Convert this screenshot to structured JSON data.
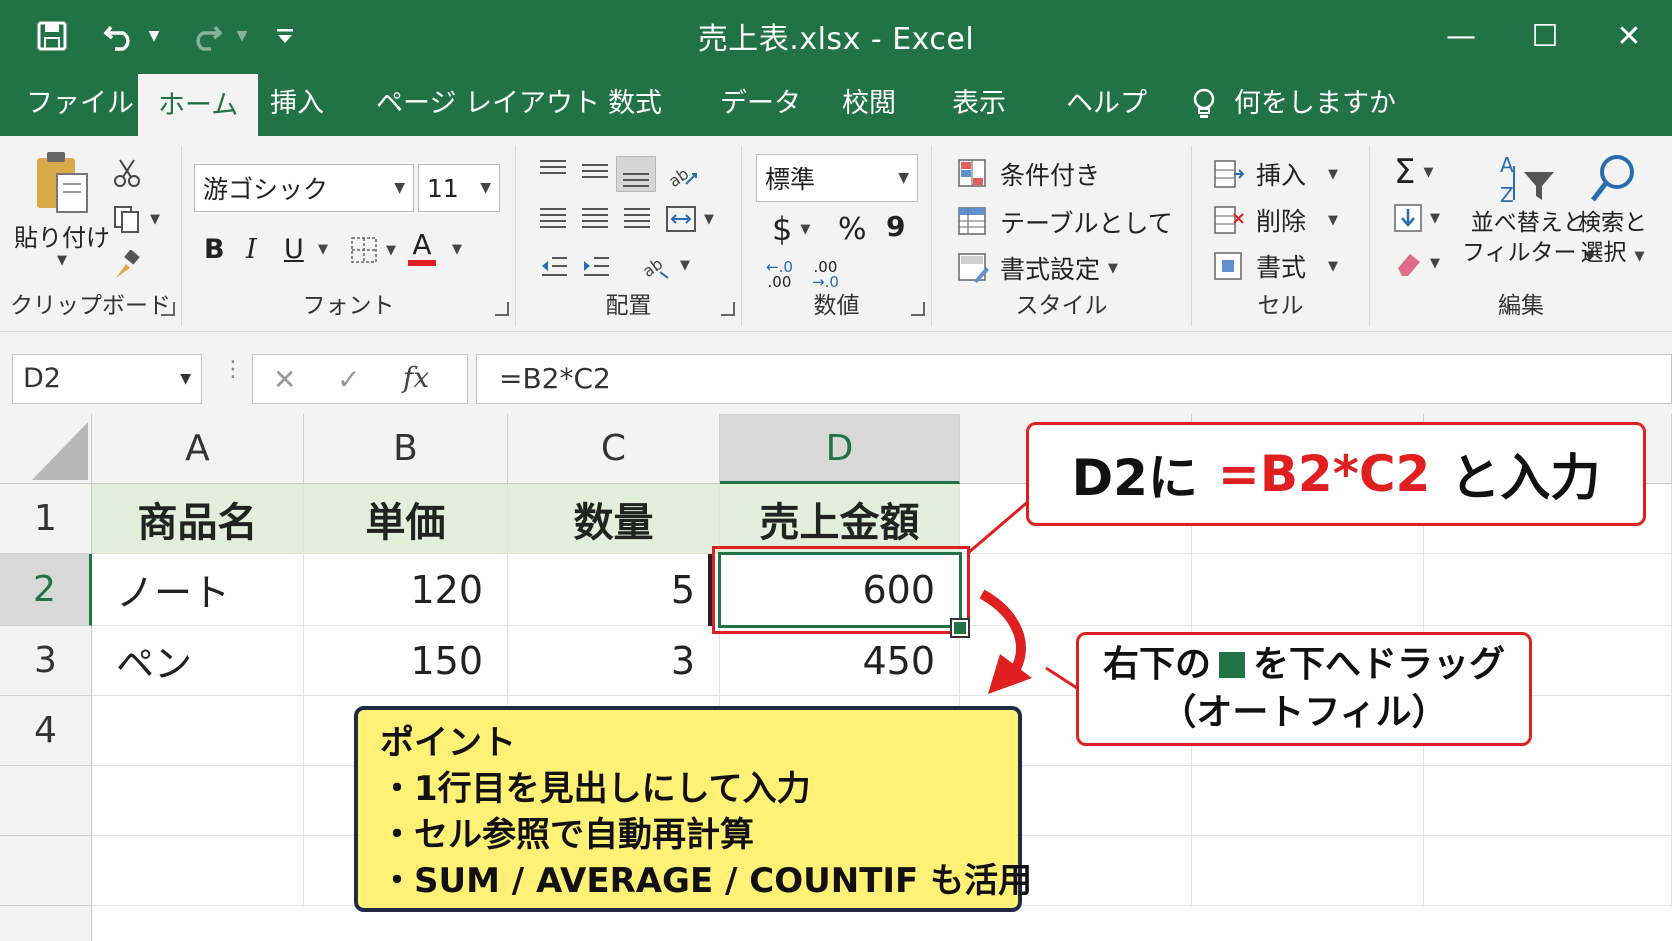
{
  "window": {
    "title": "売上表.xlsx  -  Excel",
    "controls": {
      "minimize": "—",
      "maximize": "☐",
      "close": "✕"
    }
  },
  "quick_access": {
    "save_icon": "save-icon",
    "undo_icon": "undo-icon",
    "redo_icon": "redo-icon",
    "customize_icon": "customize-icon"
  },
  "tabs": [
    {
      "label": "ファイル",
      "active": false
    },
    {
      "label": "ホーム",
      "active": true
    },
    {
      "label": "挿入",
      "active": false
    },
    {
      "label": "ページ レイアウト",
      "active": false
    },
    {
      "label": "数式",
      "active": false
    },
    {
      "label": "データ",
      "active": false
    },
    {
      "label": "校閲",
      "active": false
    },
    {
      "label": "表示",
      "active": false
    },
    {
      "label": "ヘルプ",
      "active": false
    }
  ],
  "tell_me": "何をしますか",
  "ribbon": {
    "clipboard": {
      "paste": "貼り付け",
      "label": "クリップボード"
    },
    "font": {
      "name": "游ゴシック",
      "size": "11",
      "bold": "B",
      "italic": "I",
      "underline": "U",
      "font_color_letter": "A",
      "label": "フォント"
    },
    "alignment": {
      "label": "配置"
    },
    "number": {
      "format": "標準",
      "currency": "$",
      "percent": "%",
      "comma": "9",
      "inc_decimal": ".00",
      "dec_decimal": ".0",
      "label": "数値"
    },
    "styles": {
      "conditional": "条件付き",
      "as_table": "テーブルとして",
      "cell_styles": "書式設定",
      "label": "スタイル"
    },
    "cells": {
      "insert": "挿入",
      "delete": "削除",
      "format": "書式",
      "label": "セル"
    },
    "editing": {
      "sort_line1": "並べ替えと",
      "sort_line2": "フィルター",
      "find_line1": "検索と",
      "find_line2": "選択",
      "label": "編集",
      "sigma": "Σ"
    }
  },
  "formula_bar": {
    "name_box": "D2",
    "fx": "fx",
    "formula": "=B2*C2"
  },
  "sheet": {
    "columns": [
      "A",
      "B",
      "C",
      "D"
    ],
    "rows": [
      "1",
      "2",
      "3",
      "4"
    ],
    "header_row": [
      "商品名",
      "単価",
      "数量",
      "売上金額"
    ],
    "data": [
      [
        "ノート",
        "120",
        "5",
        "600"
      ],
      [
        "ペン",
        "150",
        "3",
        "450"
      ]
    ],
    "selected_cell": "D2"
  },
  "callouts": {
    "formula": {
      "prefix": "D2に",
      "formula": "=B2*C2",
      "suffix": "と入力"
    },
    "autofill": {
      "line1_pre": "右下の",
      "line1_post": "を下へドラッグ",
      "line2": "（オートフィル）"
    },
    "point": {
      "title": "ポイント",
      "items": [
        "・1行目を見出しにして入力",
        "・セル参照で自動再計算",
        "・SUM / AVERAGE / COUNTIF も活用"
      ]
    }
  },
  "colors": {
    "excel_green": "#217346",
    "header_fill": "#e2efda",
    "callout_red": "#e02020",
    "note_yellow": "#fff176"
  }
}
